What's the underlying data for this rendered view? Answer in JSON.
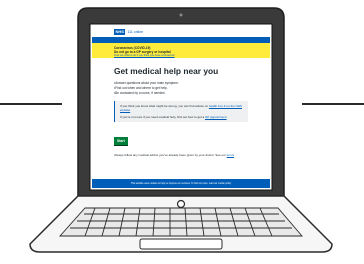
{
  "header": {
    "logo_text": "NHS",
    "service_name": "111 online"
  },
  "banner": {
    "line1": "Coronavirus (COVID-19)",
    "line2": "Do not go to a GP surgery or hospital",
    "line3": "Find out what to do if you think you have coronavirus"
  },
  "main": {
    "title": "Get medical help near you",
    "list": [
      "Answer questions about your main symptom.",
      "Find out when and where to get help.",
      "Be contacted by a nurse, if needed."
    ],
    "inset": {
      "p1_text": "If you think you know what might be wrong, you can find advice on",
      "p1_link": "health A to Z on the NHS website",
      "p2_text": "If you're not sure if you need medical help, find out how to get a",
      "p2_link": "GP appointment"
    },
    "start_button": "Start",
    "tail_text": "Always follow any medical advice you've already been given by your doctor. See our",
    "tail_link": "terms"
  },
  "footer": {
    "text": "This website uses cookies to help us improve our services. To find out more, read our cookie policy"
  },
  "colors": {
    "nhs_blue": "#005eb8",
    "banner_yellow": "#ffeb3b",
    "start_green": "#007f3b"
  }
}
